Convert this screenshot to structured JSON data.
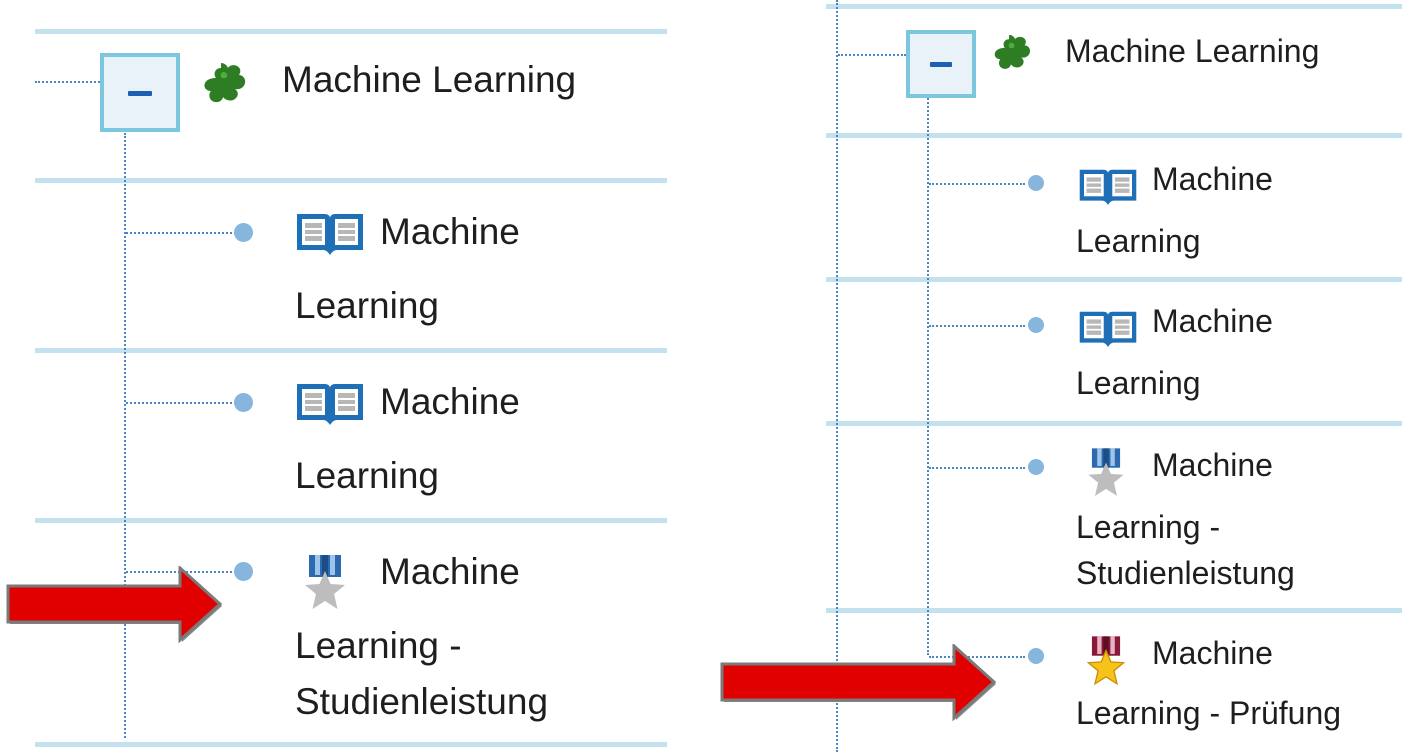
{
  "left_tree": {
    "root": {
      "label": "Machine Learning",
      "toggle_symbol": "−",
      "icon": "puzzle-icon"
    },
    "children": [
      {
        "icon": "book-icon",
        "line1": "Machine",
        "line2": "Learning"
      },
      {
        "icon": "book-icon",
        "line1": "Machine",
        "line2": "Learning"
      },
      {
        "icon": "medal-silver-icon",
        "line1": "Machine",
        "line2": "Learning -",
        "line3": "Studienleistung"
      }
    ]
  },
  "right_tree": {
    "root": {
      "label": "Machine Learning",
      "toggle_symbol": "−",
      "icon": "puzzle-icon"
    },
    "children": [
      {
        "icon": "book-icon",
        "line1": "Machine",
        "line2": "Learning"
      },
      {
        "icon": "book-icon",
        "line1": "Machine",
        "line2": "Learning"
      },
      {
        "icon": "medal-silver-icon",
        "line1": "Machine",
        "line2": "Learning -",
        "line3": "Studienleistung"
      },
      {
        "icon": "medal-gold-icon",
        "line1": "Machine",
        "line2": "Learning - Prüfung"
      }
    ]
  },
  "annotations": {
    "arrow_color": "#e00000"
  },
  "colors": {
    "row_divider": "#c3e1ef",
    "tree_line": "#4a86c8",
    "puzzle": "#2e8b2e",
    "book": "#1e6fb8"
  }
}
